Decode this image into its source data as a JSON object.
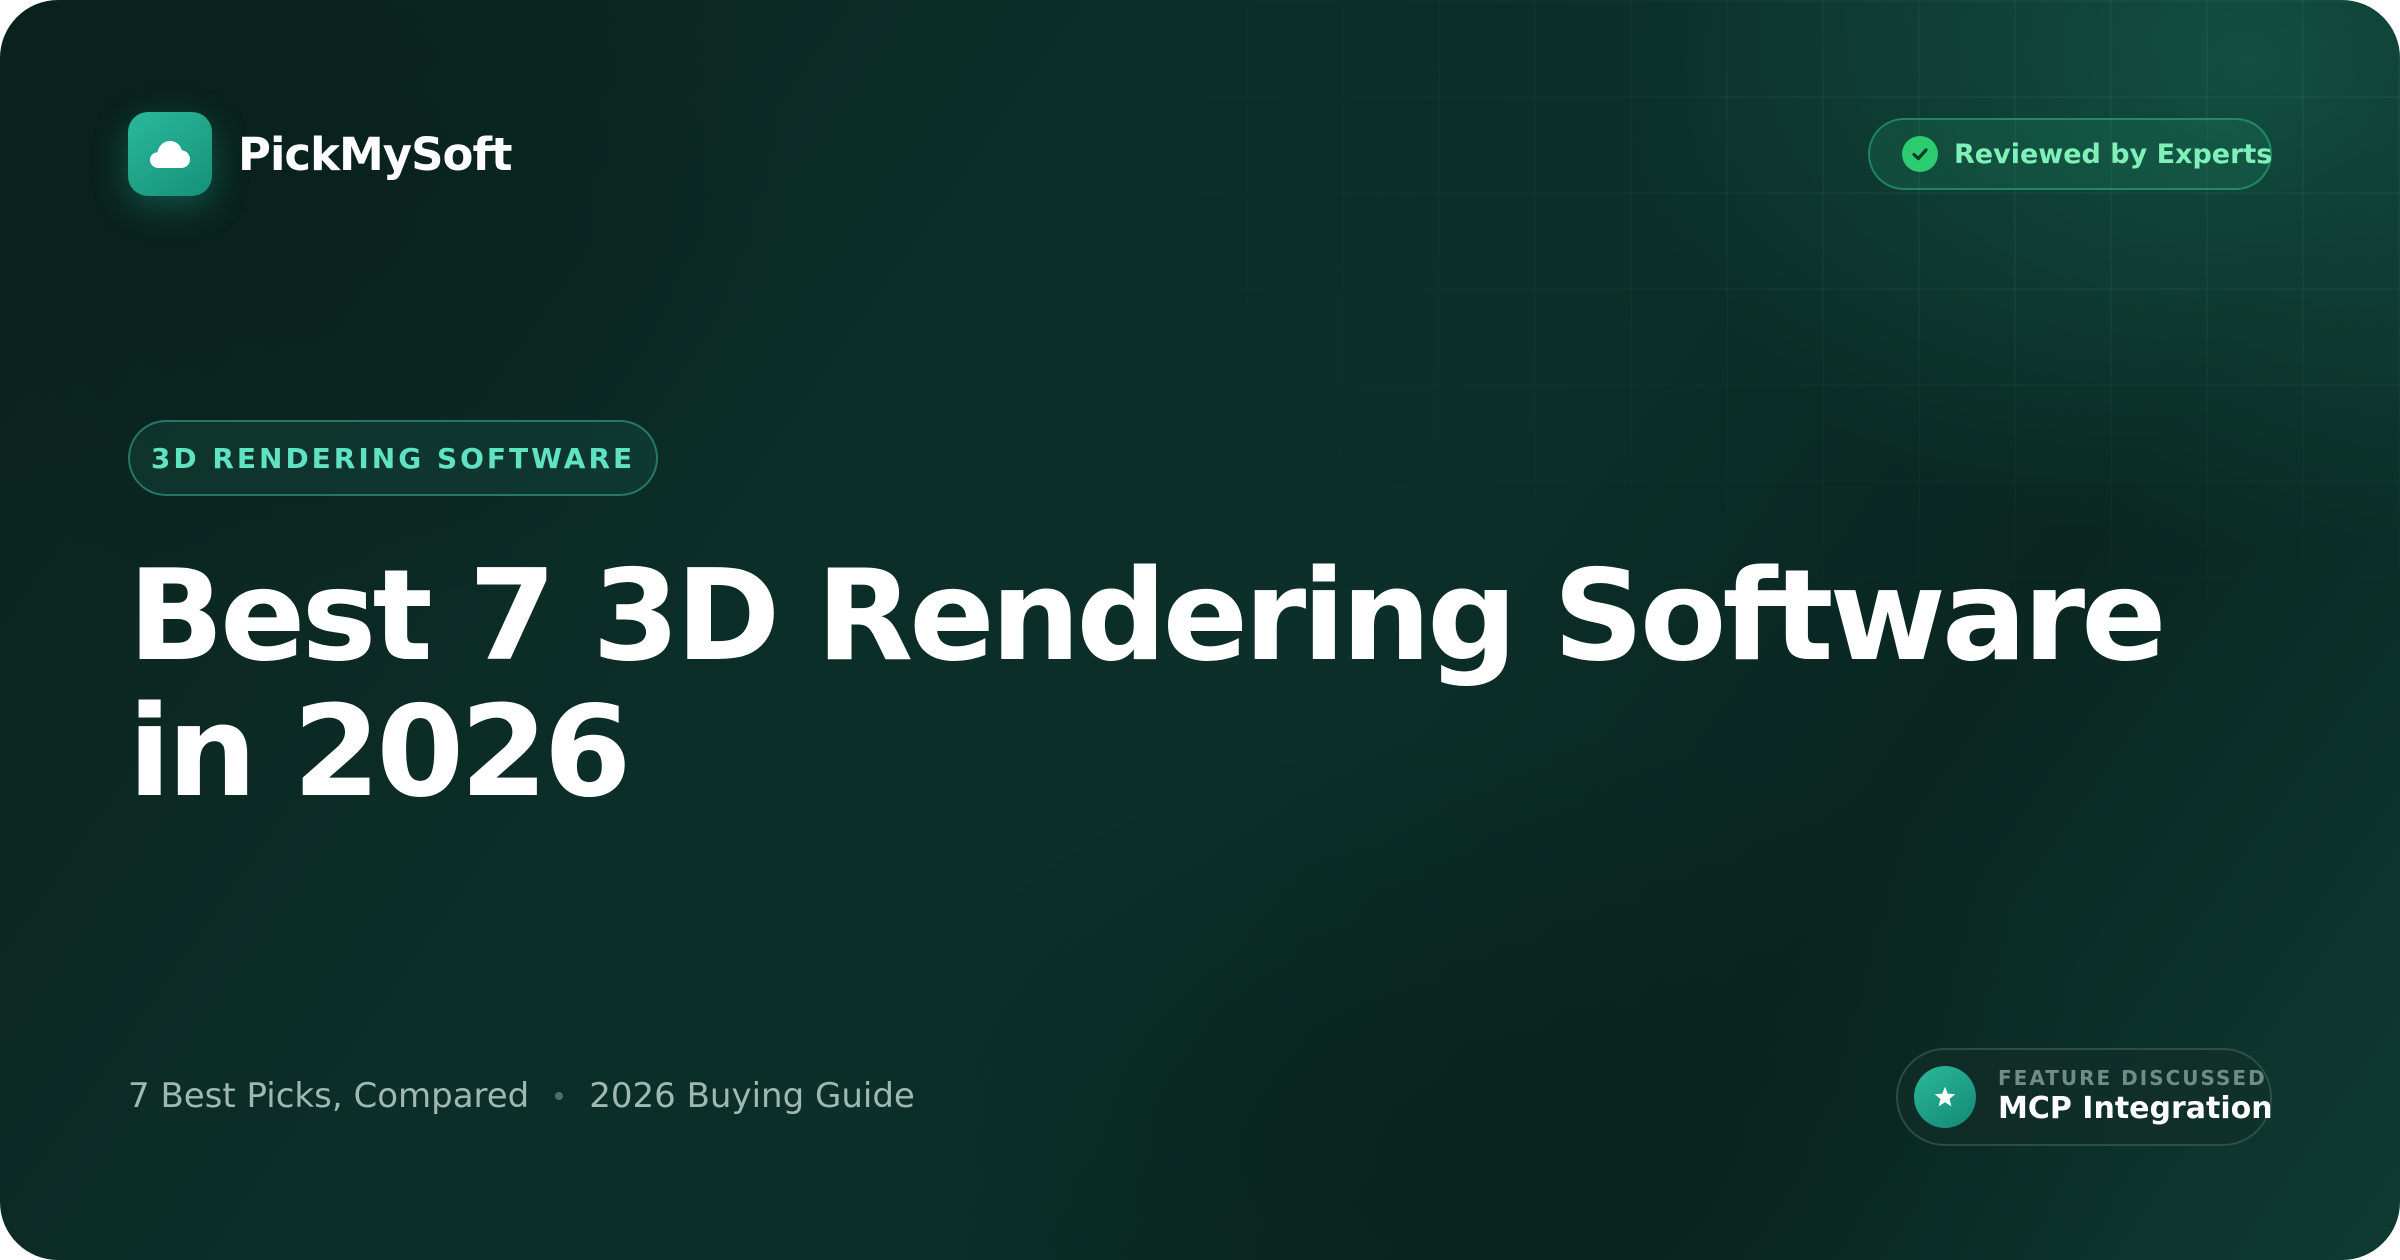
{
  "brand": {
    "name": "PickMySoft",
    "logo_icon": "cloud-icon",
    "logo_color": "#1fa88c"
  },
  "badge": {
    "icon": "check-circle-icon",
    "text": "Reviewed by Experts",
    "color": "#7ef0b8"
  },
  "category": {
    "label": "3D RENDERING SOFTWARE",
    "color": "#5fe3c2"
  },
  "title": {
    "line1": "Best 7 3D Rendering Software",
    "line2": "in 2026"
  },
  "meta": {
    "picks": "7 Best Picks, Compared",
    "guide": "2026 Buying Guide"
  },
  "feature": {
    "icon": "star-icon",
    "label": "FEATURE DISCUSSED",
    "value": "MCP Integration"
  },
  "colors": {
    "background": "#0c2e28",
    "accent": "#1fa88c"
  }
}
